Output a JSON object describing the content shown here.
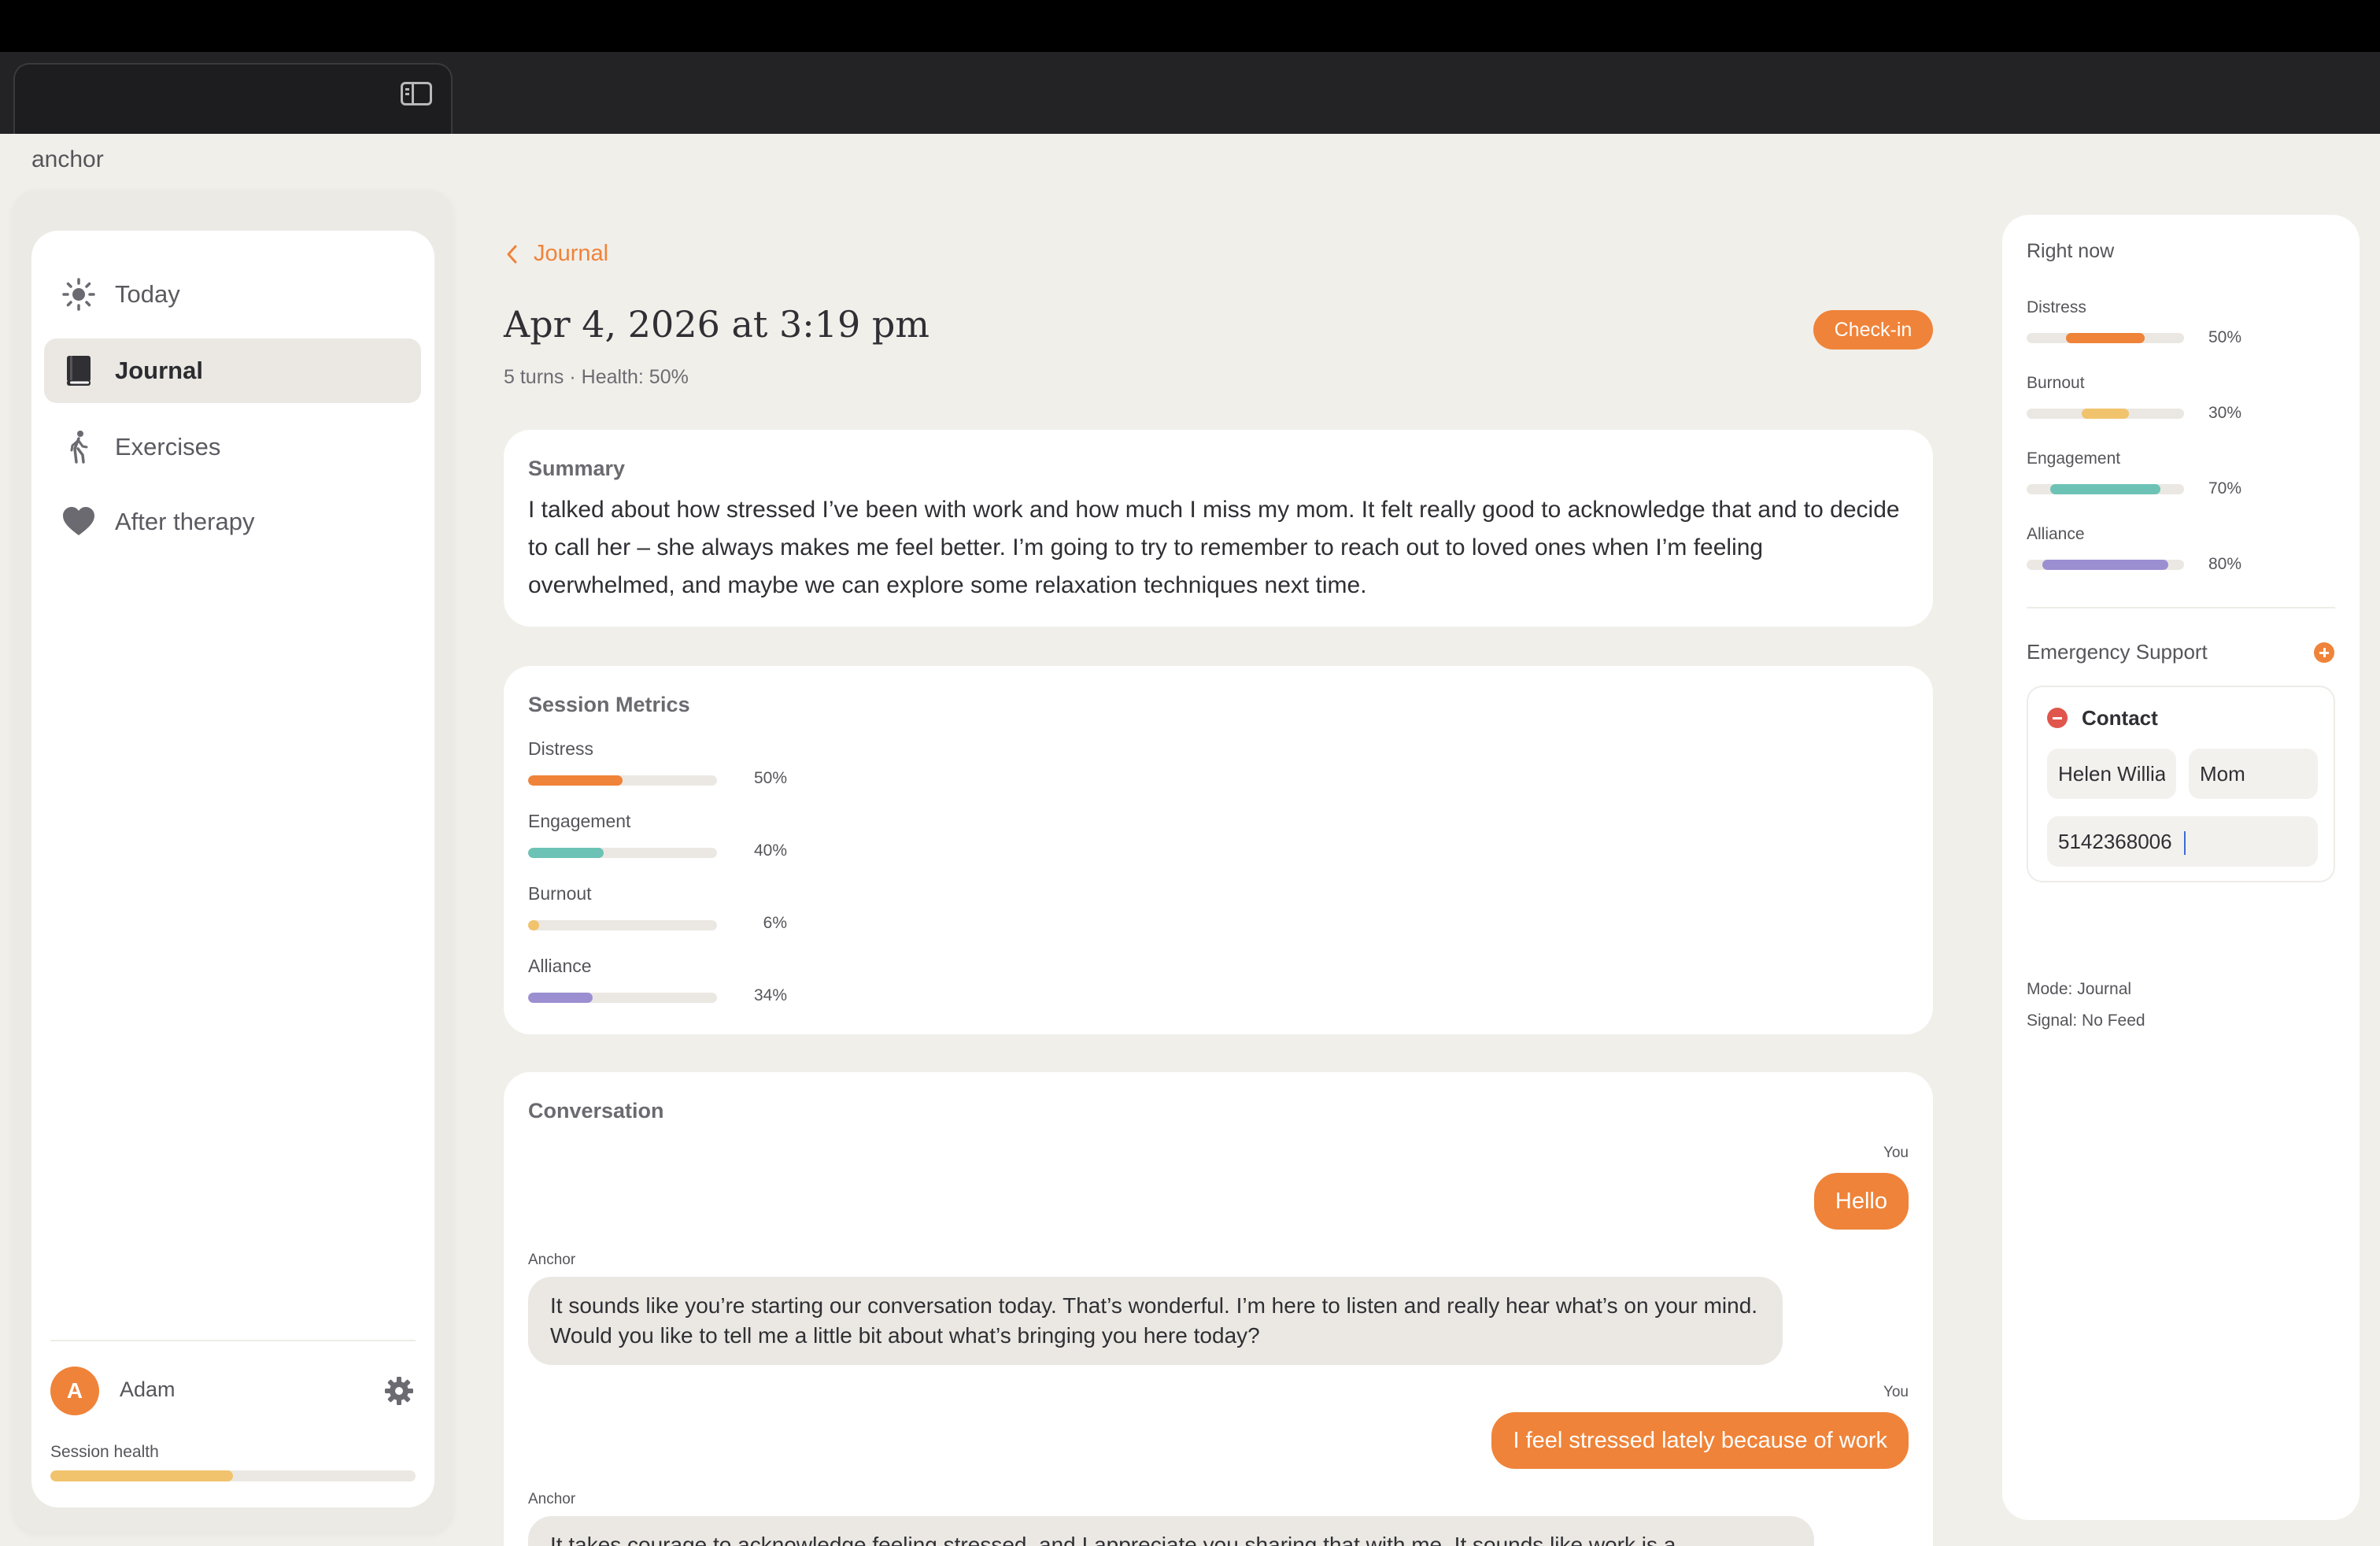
{
  "app": {
    "name": "anchor"
  },
  "sidebar": {
    "items": [
      {
        "label": "Today",
        "icon": "sun-icon"
      },
      {
        "label": "Journal",
        "icon": "book-icon",
        "active": true
      },
      {
        "label": "Exercises",
        "icon": "walking-person-icon"
      },
      {
        "label": "After therapy",
        "icon": "heart-icon"
      }
    ],
    "user": {
      "initial": "A",
      "name": "Adam"
    },
    "session_health": {
      "label": "Session health",
      "value": 0.5
    }
  },
  "header": {
    "back_label": "Journal",
    "title": "Apr 4, 2026 at 3:19 pm",
    "subtitle": "5 turns · Health: 50%",
    "badge": "Check-in"
  },
  "summary": {
    "title": "Summary",
    "text": "I talked about how stressed I’ve been with work and how much I miss my mom. It felt really good to acknowledge that and to decide to call her – she always makes me feel better. I’m going to try to remember to reach out to loved ones when I’m feeling overwhelmed, and maybe we can explore some relaxation techniques next time."
  },
  "session_metrics": {
    "title": "Session Metrics",
    "items": [
      {
        "label": "Distress",
        "value": 50,
        "display": "50%",
        "color": "#ef8339"
      },
      {
        "label": "Engagement",
        "value": 40,
        "display": "40%",
        "color": "#6cc3b5"
      },
      {
        "label": "Burnout",
        "value": 6,
        "display": "6%",
        "color": "#f1c36d"
      },
      {
        "label": "Alliance",
        "value": 34,
        "display": "34%",
        "color": "#9b8fd1"
      }
    ]
  },
  "conversation": {
    "title": "Conversation",
    "messages": [
      {
        "sender": "You",
        "text": "Hello"
      },
      {
        "sender": "Anchor",
        "text": "It sounds like you’re starting our conversation today. That’s wonderful. I’m here to listen and really hear what’s on your mind. Would you like to tell me a little bit about what’s bringing you here today?"
      },
      {
        "sender": "You",
        "text": "I feel stressed lately because of work"
      },
      {
        "sender": "Anchor",
        "text": "It takes courage to acknowledge feeling stressed, and I appreciate you sharing that with me. It sounds like work is a"
      }
    ]
  },
  "right_panel": {
    "title": "Right now",
    "metrics": [
      {
        "label": "Distress",
        "start": 25,
        "value": 50,
        "display": "50%",
        "color": "#ef8339"
      },
      {
        "label": "Burnout",
        "start": 35,
        "value": 30,
        "display": "30%",
        "color": "#f1c36d"
      },
      {
        "label": "Engagement",
        "start": 15,
        "value": 70,
        "display": "70%",
        "color": "#6cc3b5"
      },
      {
        "label": "Alliance",
        "start": 10,
        "value": 80,
        "display": "80%",
        "color": "#9b8fd1"
      }
    ],
    "emergency": {
      "title": "Emergency Support",
      "contact_title": "Contact",
      "name_value": "Helen Williams",
      "relation_value": "Mom",
      "phone_value": "5142368006"
    },
    "mode": "Mode: Journal",
    "signal": "Signal: No Feed"
  }
}
